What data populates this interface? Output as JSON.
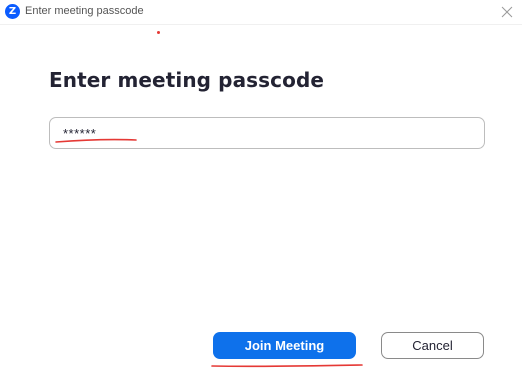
{
  "window": {
    "title": "Enter meeting passcode",
    "logo_letter": "Z",
    "close_icon": "close-icon"
  },
  "dialog": {
    "heading": "Enter meeting passcode",
    "passcode_value": "******"
  },
  "buttons": {
    "join_label": "Join Meeting",
    "cancel_label": "Cancel"
  },
  "colors": {
    "brand": "#0B5CFF",
    "primary_button": "#0E71EB",
    "annotation": "#e53935"
  }
}
